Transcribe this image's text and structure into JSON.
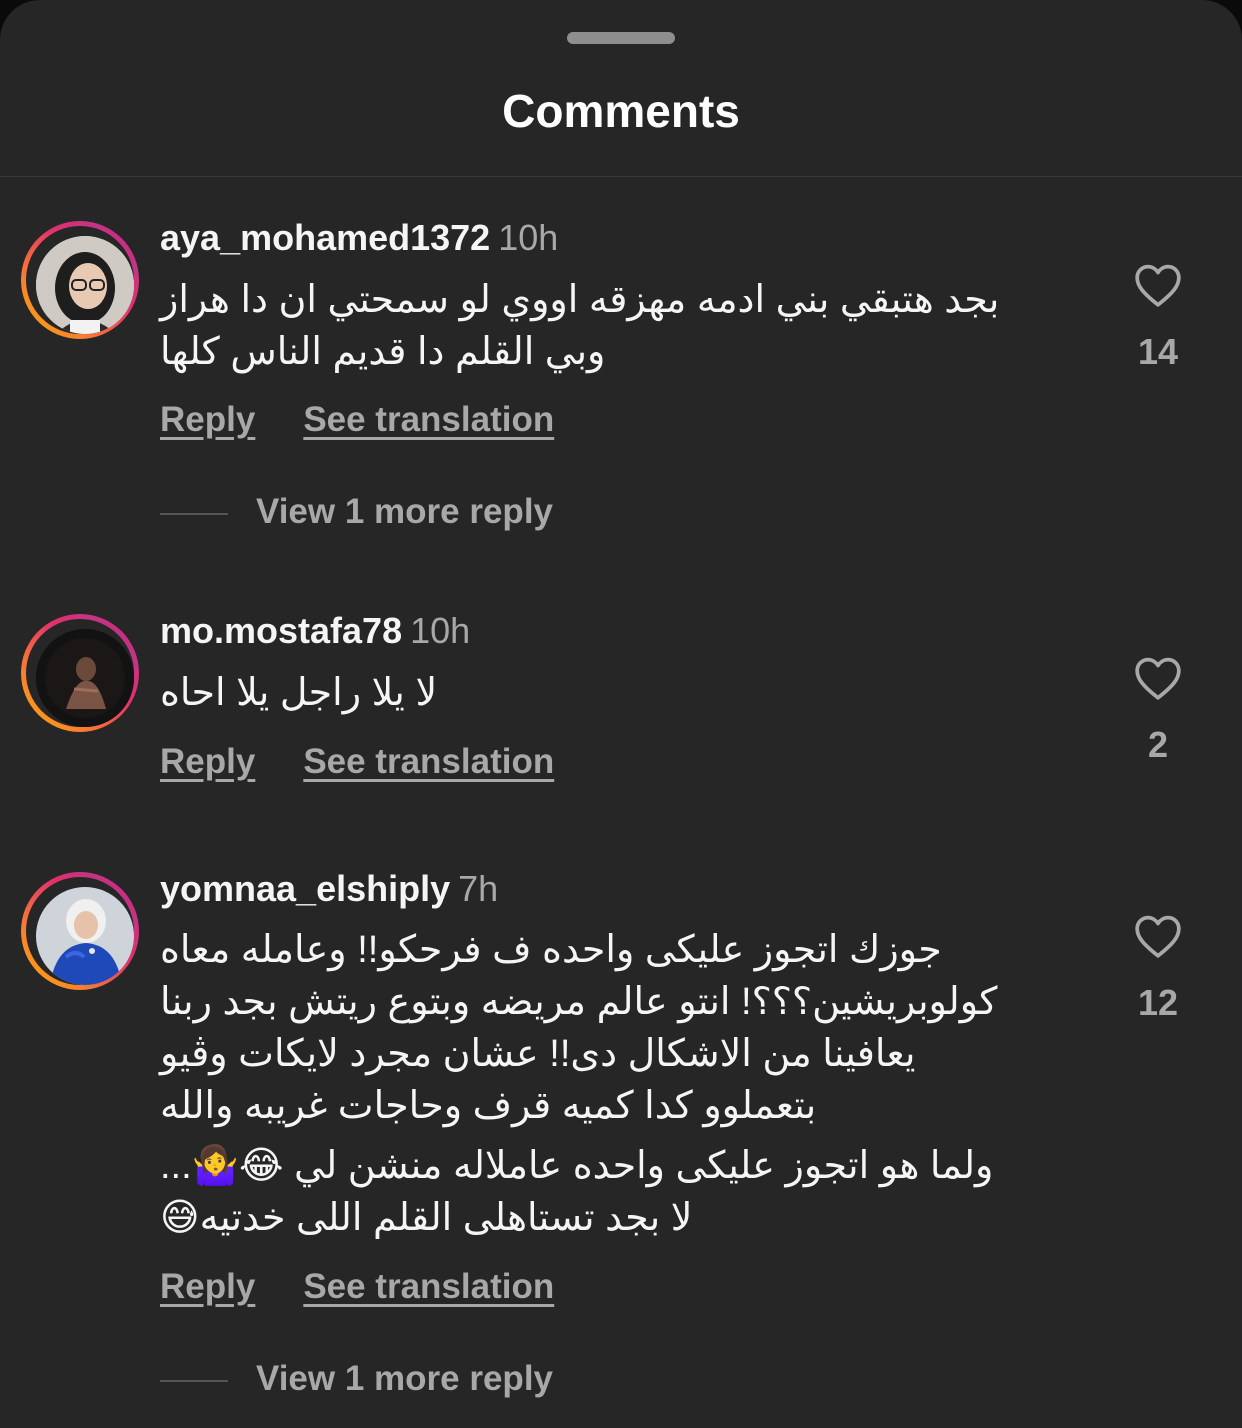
{
  "header": {
    "title": "Comments"
  },
  "comments": [
    {
      "username": "aya_mohamed1372",
      "time": "10h",
      "lines": [
        "بجد هتبقي بني ادمه مهزقه اووي لو سمحتي ان دا هراز",
        "وبي القلم دا قديم الناس كلها"
      ],
      "reply_label": "Reply",
      "translate_label": "See translation",
      "view_more": "View 1 more reply",
      "likes": "14"
    },
    {
      "username": "mo.mostafa78",
      "time": "10h",
      "lines": [
        "لا يلا راجل يلا احاه"
      ],
      "reply_label": "Reply",
      "translate_label": "See translation",
      "likes": "2"
    },
    {
      "username": "yomnaa_elshiply",
      "time": "7h",
      "lines": [
        "جوزك اتجوز عليكى واحده ف فرحكو!! وعامله معاه",
        "كولوبريشين؟؟؟! انتو عالم مريضه وبتوع ريتش بجد ربنا",
        "يعافينا من الاشكال دى!! عشان مجرد لايكات وڤيو",
        "بتعملوو كدا كميه قرف وحاجات غريبه والله"
      ],
      "lines2": [
        "ولما هو اتجوز عليكى واحده عاملاله منشن لي 😂🤷‍♀️...",
        "لا بجد تستاهلى القلم اللى خدتيه😅"
      ],
      "reply_label": "Reply",
      "translate_label": "See translation",
      "view_more": "View 1 more reply",
      "likes": "12"
    }
  ]
}
